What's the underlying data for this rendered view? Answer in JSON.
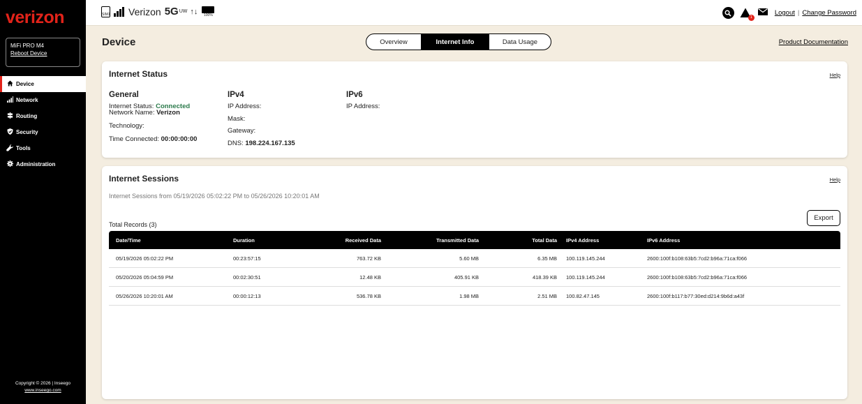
{
  "brand": {
    "logo": "verizon",
    "accent": "#e2231a"
  },
  "sidebar": {
    "device_name": "MiFi PRO M4",
    "reboot_label": "Reboot Device",
    "items": [
      {
        "label": "Device",
        "icon": "home-icon",
        "active": true
      },
      {
        "label": "Network",
        "icon": "signal-bars-icon"
      },
      {
        "label": "Routing",
        "icon": "signpost-icon"
      },
      {
        "label": "Security",
        "icon": "shield-icon"
      },
      {
        "label": "Tools",
        "icon": "wrench-icon"
      },
      {
        "label": "Administration",
        "icon": "gear-icon"
      }
    ],
    "copyright": "Copyright © 2026 | Inseego",
    "copyright_link": "www.inseego.com"
  },
  "topbar": {
    "sim_label": "SIM1",
    "carrier": "Verizon",
    "network_type": "5G",
    "network_sub": "UW",
    "battery": "100%",
    "alert_count": "1",
    "logout": "Logout",
    "change_password": "Change Password"
  },
  "header": {
    "title": "Device",
    "tabs": [
      "Overview",
      "Internet Info",
      "Data Usage"
    ],
    "active_tab": "Internet Info",
    "product_doc": "Product Documentation"
  },
  "internet_status": {
    "title": "Internet Status",
    "help": "Help",
    "general": {
      "heading": "General",
      "status_label": "Internet Status:",
      "status_value": "Connected",
      "network_label": "Network Name:",
      "network_value": "Verizon",
      "technology_label": "Technology:",
      "technology_value": "",
      "time_label": "Time Connected:",
      "time_value": "00:00:00:00"
    },
    "ipv4": {
      "heading": "IPv4",
      "ip_label": "IP Address:",
      "mask_label": "Mask:",
      "gateway_label": "Gateway:",
      "dns_label": "DNS:",
      "dns_value": "198.224.167.135"
    },
    "ipv6": {
      "heading": "IPv6",
      "ip_label": "IP Address:"
    }
  },
  "sessions": {
    "title": "Internet Sessions",
    "help": "Help",
    "range": "Internet Sessions from 05/19/2026 05:02:22 PM to 05/26/2026 10:20:01 AM",
    "total_records": "Total Records (3)",
    "export_label": "Export",
    "columns": [
      "Date/Time",
      "Duration",
      "Received Data",
      "Transmitted Data",
      "Total Data",
      "IPv4 Address",
      "IPv6 Address"
    ],
    "rows": [
      [
        "05/19/2026 05:02:22 PM",
        "00:23:57:15",
        "763.72 KB",
        "5.60 MB",
        "6.35 MB",
        "100.119.145.244",
        "2600:100f:b108:63b5:7cd2:b96a:71ca:f066"
      ],
      [
        "05/20/2026 05:04:59 PM",
        "00:02:30:51",
        "12.48 KB",
        "405.91 KB",
        "418.39 KB",
        "100.119.145.244",
        "2600:100f:b108:63b5:7cd2:b96a:71ca:f066"
      ],
      [
        "05/26/2026 10:20:01 AM",
        "00:00:12:13",
        "536.78 KB",
        "1.98 MB",
        "2.51 MB",
        "100.82.47.145",
        "2600:100f:b117:b77:30ed:d214:9b6d:a43f"
      ]
    ]
  }
}
